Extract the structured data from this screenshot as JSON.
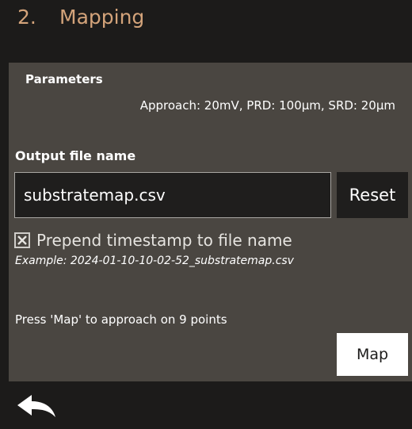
{
  "header": {
    "step_number": "2.",
    "title": "Mapping"
  },
  "parameters": {
    "title": "Parameters",
    "summary": "Approach: 20mV, PRD: 100μm, SRD: 20μm"
  },
  "output": {
    "label": "Output file name",
    "filename_value": "substratemap.csv",
    "reset_label": "Reset",
    "prepend_checked": true,
    "prepend_label": "Prepend timestamp to file name",
    "example": "Example: 2024-01-10-10-02-52_substratemap.csv"
  },
  "mapping": {
    "hint": "Press 'Map' to approach on 9 points",
    "map_label": "Map"
  },
  "icons": {
    "back": "back-arrow-icon",
    "checkbox": "checkbox-checked-icon"
  },
  "colors": {
    "background": "#1c1b1a",
    "panel": "#4a4641",
    "accent": "#d3a37a",
    "button_dark": "#1f1e1d",
    "button_light": "#ffffff"
  }
}
